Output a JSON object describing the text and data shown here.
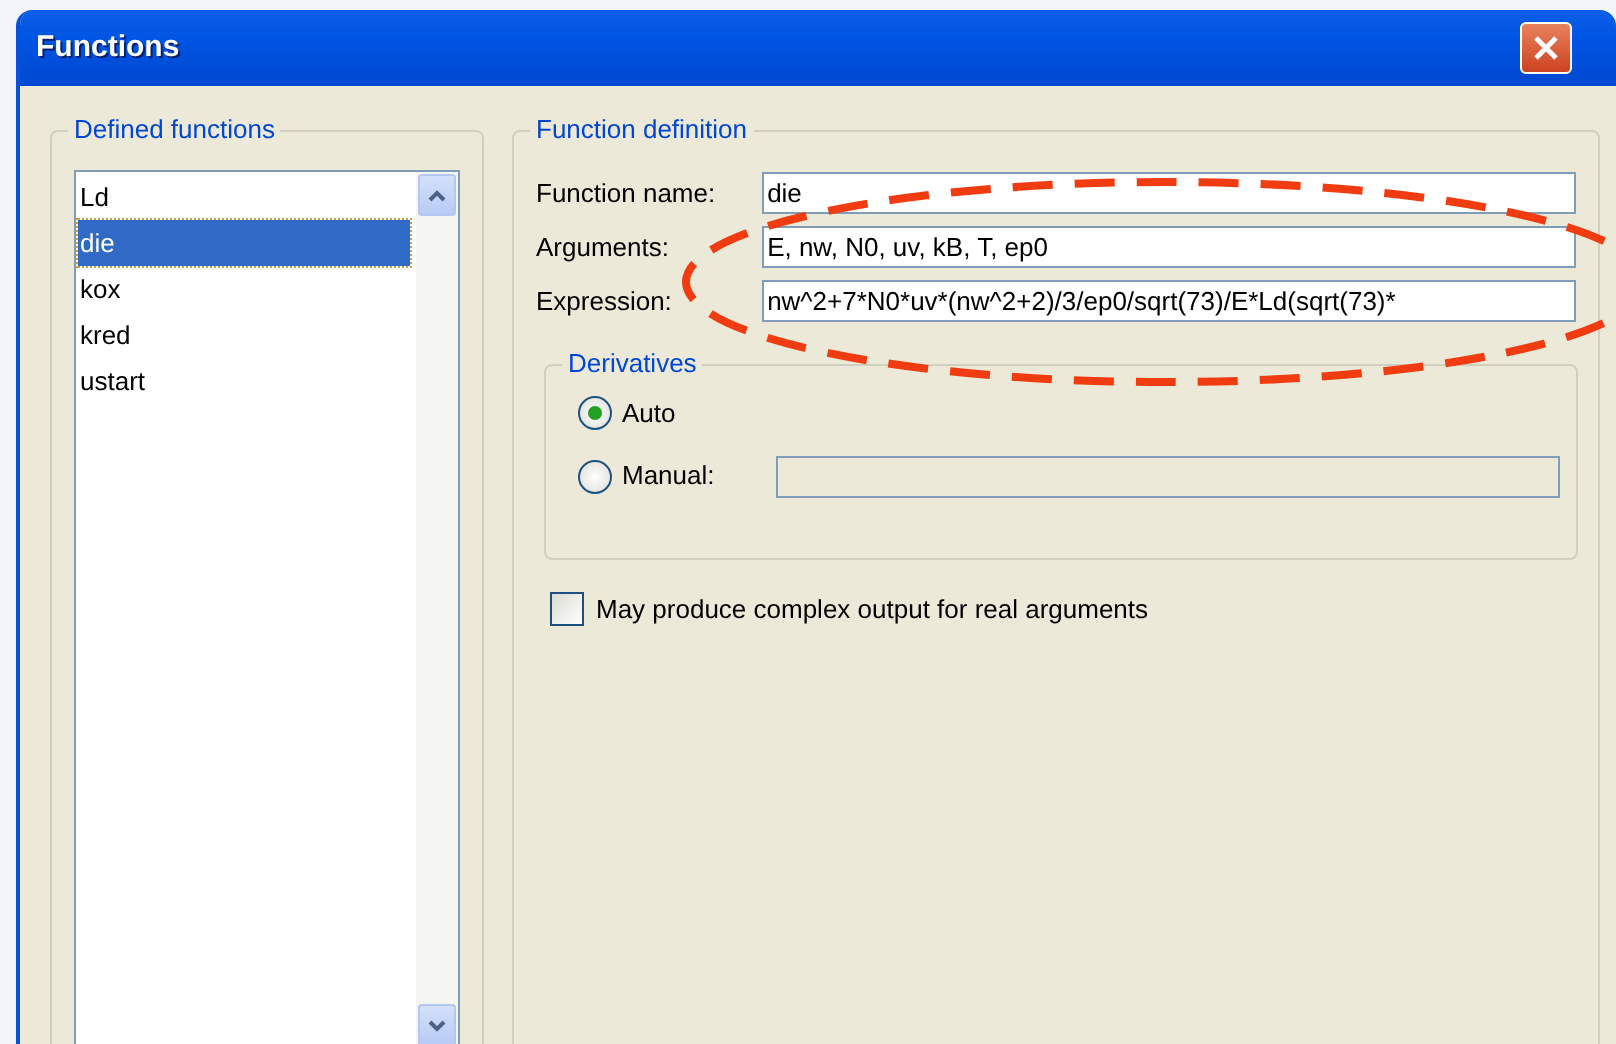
{
  "window": {
    "title": "Functions"
  },
  "defined_functions": {
    "title": "Defined functions",
    "items": [
      {
        "label": "Ld",
        "selected": false
      },
      {
        "label": "die",
        "selected": true
      },
      {
        "label": "kox",
        "selected": false
      },
      {
        "label": "kred",
        "selected": false
      },
      {
        "label": "ustart",
        "selected": false
      }
    ]
  },
  "function_definition": {
    "title": "Function definition",
    "fields": [
      {
        "label": "Function name:",
        "value": "die"
      },
      {
        "label": "Arguments:",
        "value": "E, nw, N0, uv, kB, T, ep0"
      },
      {
        "label": "Expression:",
        "value": "nw^2+7*N0*uv*(nw^2+2)/3/ep0/sqrt(73)/E*Ld(sqrt(73)*"
      }
    ],
    "derivatives": {
      "title": "Derivatives",
      "options": [
        {
          "label": "Auto",
          "selected": true,
          "kind": "plain"
        },
        {
          "label": "Manual:",
          "selected": false,
          "kind": "with_field"
        }
      ]
    },
    "complex_output": {
      "label": "May produce complex output for real arguments",
      "checked": false
    }
  }
}
